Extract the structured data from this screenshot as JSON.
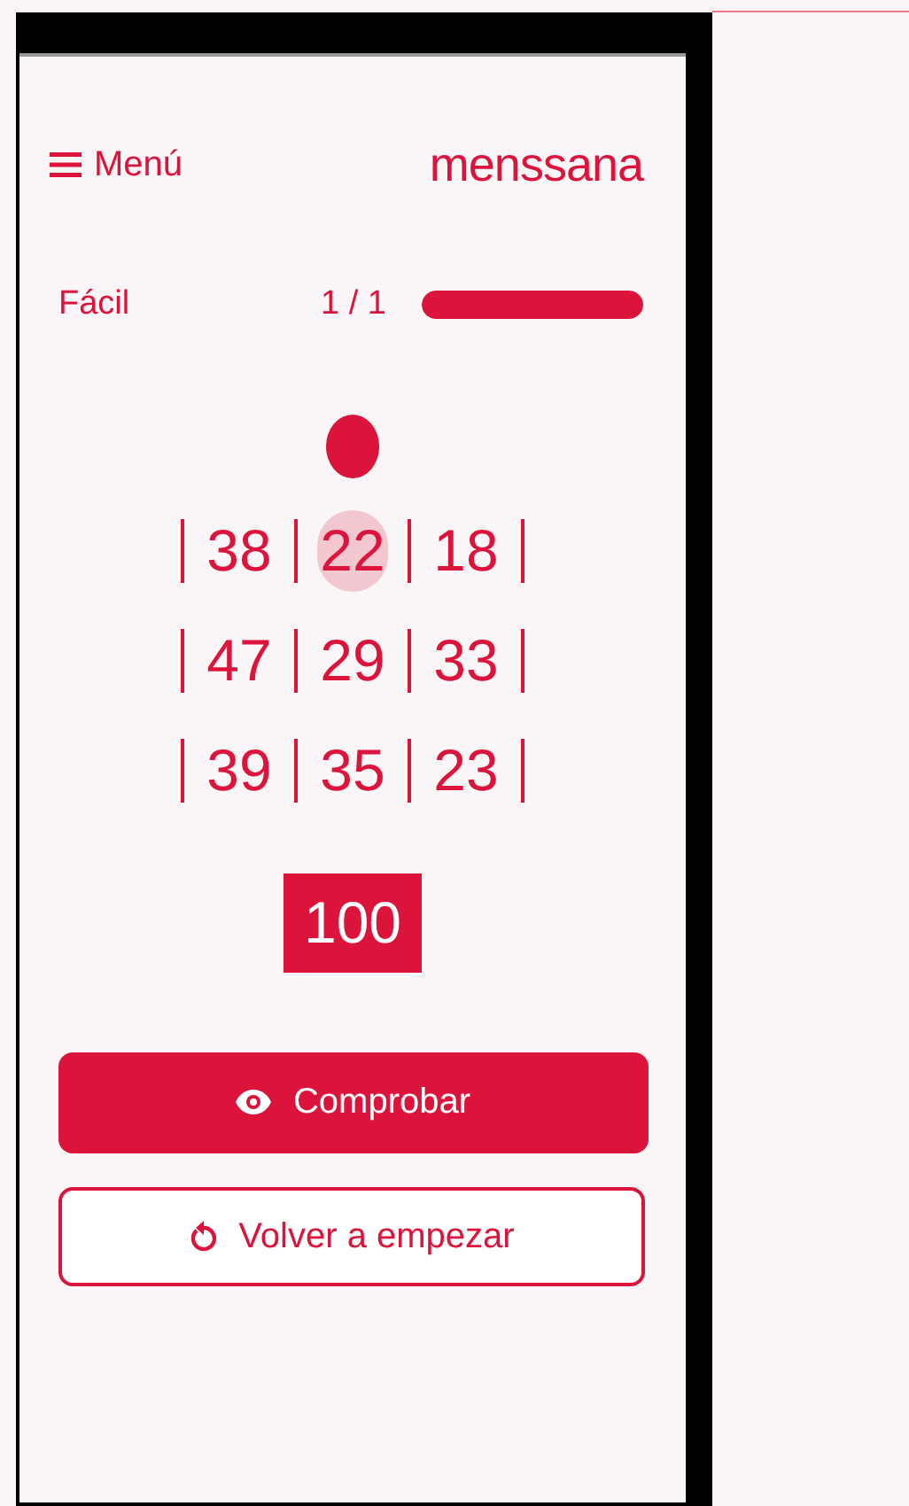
{
  "header": {
    "menu_label": "Menú",
    "logo": "menssana"
  },
  "progress": {
    "difficulty": "Fácil",
    "counter": "1 / 1",
    "level": 1
  },
  "grid": [
    [
      {
        "value": "38",
        "selected": false
      },
      {
        "value": "22",
        "selected": true
      },
      {
        "value": "18",
        "selected": false
      }
    ],
    [
      {
        "value": "47",
        "selected": false
      },
      {
        "value": "29",
        "selected": false
      },
      {
        "value": "33",
        "selected": false
      }
    ],
    [
      {
        "value": "39",
        "selected": false
      },
      {
        "value": "35",
        "selected": false
      },
      {
        "value": "23",
        "selected": false
      }
    ]
  ],
  "target": "100",
  "buttons": [
    {
      "label": "Comprobar",
      "kind": "primary"
    },
    {
      "label": "Volver a empezar",
      "kind": "secondary"
    }
  ]
}
